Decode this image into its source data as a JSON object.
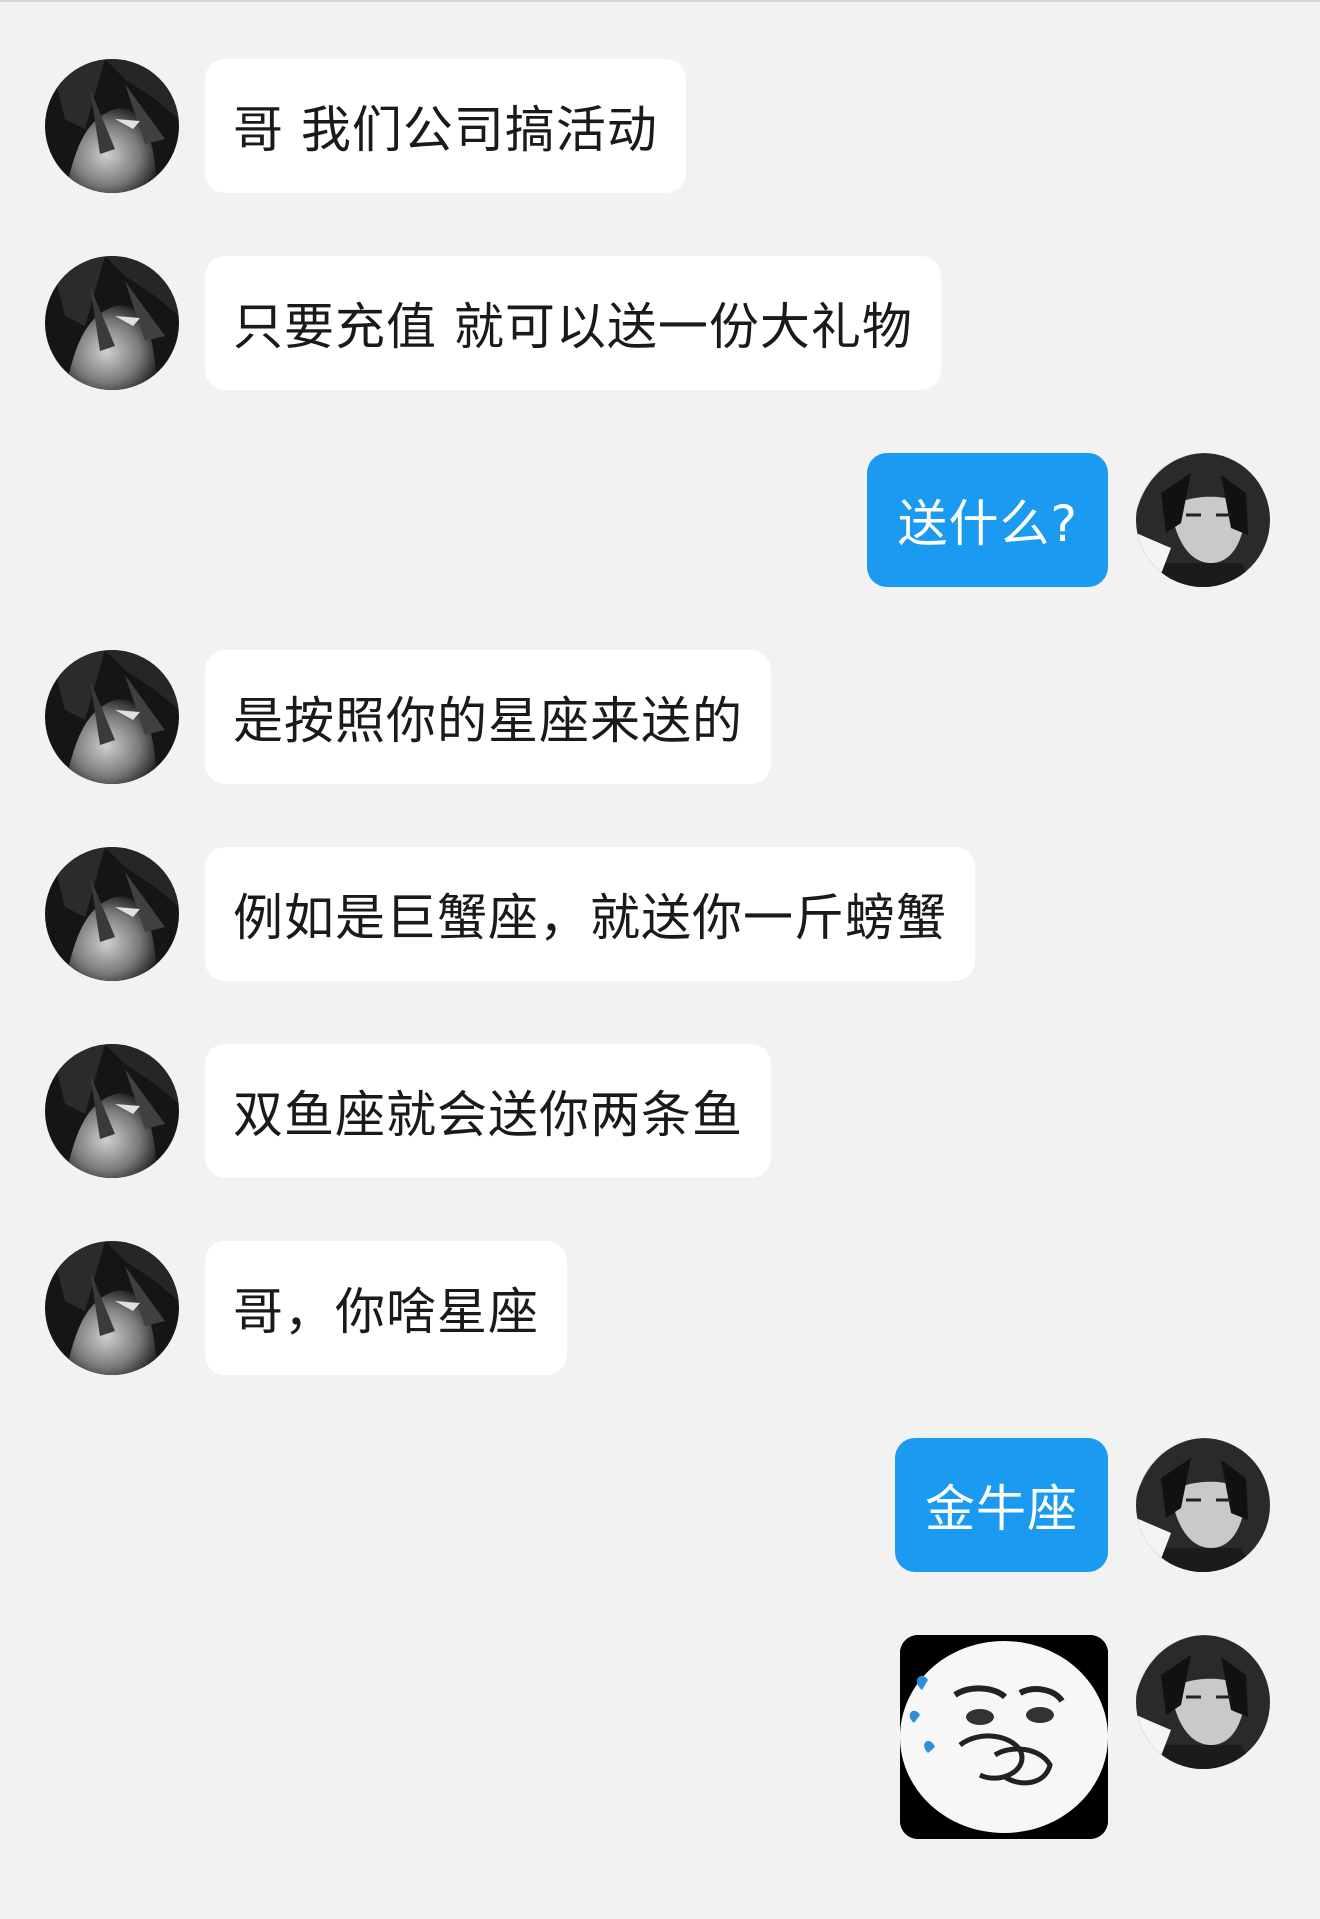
{
  "messages": [
    {
      "side": "left",
      "avatar": "dark-haired-character-avatar",
      "text": "哥 我们公司搞活动"
    },
    {
      "side": "left",
      "avatar": "dark-haired-character-avatar",
      "text": "只要充值 就可以送一份大礼物"
    },
    {
      "side": "right",
      "avatar": "black-haired-boy-avatar",
      "text": "送什么?"
    },
    {
      "side": "left",
      "avatar": "dark-haired-character-avatar",
      "text": "是按照你的星座来送的"
    },
    {
      "side": "left",
      "avatar": "dark-haired-character-avatar",
      "text": "例如是巨蟹座，就送你一斤螃蟹"
    },
    {
      "side": "left",
      "avatar": "dark-haired-character-avatar",
      "text": "双鱼座就会送你两条鱼"
    },
    {
      "side": "left",
      "avatar": "dark-haired-character-avatar",
      "text": "哥，你啥星座"
    },
    {
      "side": "right",
      "avatar": "black-haired-boy-avatar",
      "text": "金牛座"
    },
    {
      "side": "right",
      "avatar": "black-haired-boy-avatar",
      "type": "sticker",
      "sticker": "drooling-panda-face-sticker"
    }
  ],
  "colors": {
    "background": "#f2f2f2",
    "incoming_bubble": "#ffffff",
    "outgoing_bubble": "#1a9bf1",
    "incoming_text": "#1a1a1a",
    "outgoing_text": "#ffffff"
  }
}
